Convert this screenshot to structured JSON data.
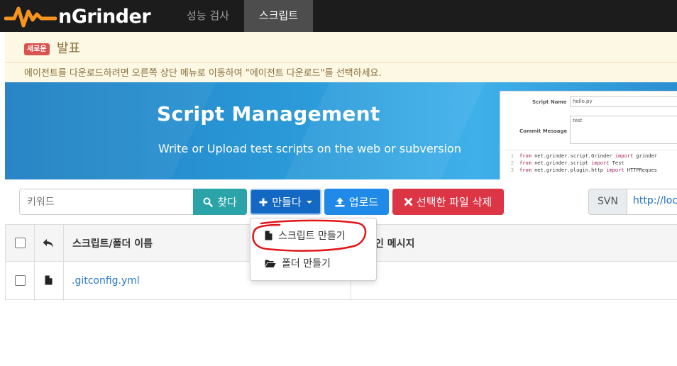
{
  "app": {
    "name": "nGrinder",
    "nav": {
      "performance_test": "성능 검사",
      "script": "스크립트"
    }
  },
  "announcement": {
    "badge": "새로운",
    "title": "발표",
    "message": "에이전트를 다운로드하려면 오른쪽 상단 메뉴로 이동하여 \"에이전트 다운로드\"를 선택하세요."
  },
  "banner": {
    "title": "Script Management",
    "subtitle": "Write or Upload test scripts on the web or subversion",
    "mock": {
      "script_name_label": "Script Name",
      "script_name_value": "hello.py",
      "commit_label": "Commit Message",
      "commit_value": "test",
      "code_lines": [
        {
          "no": "1",
          "a": "from",
          "b": " net.grinder.script.Grinder ",
          "c": "import",
          "d": " grinder"
        },
        {
          "no": "2",
          "a": "from",
          "b": " net.grinder.script ",
          "c": "import",
          "d": " Test"
        },
        {
          "no": "3",
          "a": "from",
          "b": " net.grinder.plugin.http ",
          "c": "import",
          "d": " HTTPReques"
        }
      ]
    }
  },
  "toolbar": {
    "search_placeholder": "키워드",
    "search_button": "찾다",
    "create_button": "만들다",
    "upload_button": "업로드",
    "delete_button": "선택한 파일 삭제",
    "svn_label": "SVN",
    "svn_url": "http://loca"
  },
  "table": {
    "headers": {
      "name": "스크립트/폴더 이름",
      "message": "인 메시지"
    },
    "rows": [
      {
        "name": ".gitconfig.yml"
      }
    ]
  },
  "dropdown": {
    "items": [
      "스크립트 만들기",
      "폴더 만들기"
    ]
  },
  "colors": {
    "navbar": "#1c1c1c",
    "logo_orange": "#f7941d",
    "annotation_red": "#e0161b",
    "create_blue": "#1268c2",
    "delete_red": "#dc3545"
  }
}
